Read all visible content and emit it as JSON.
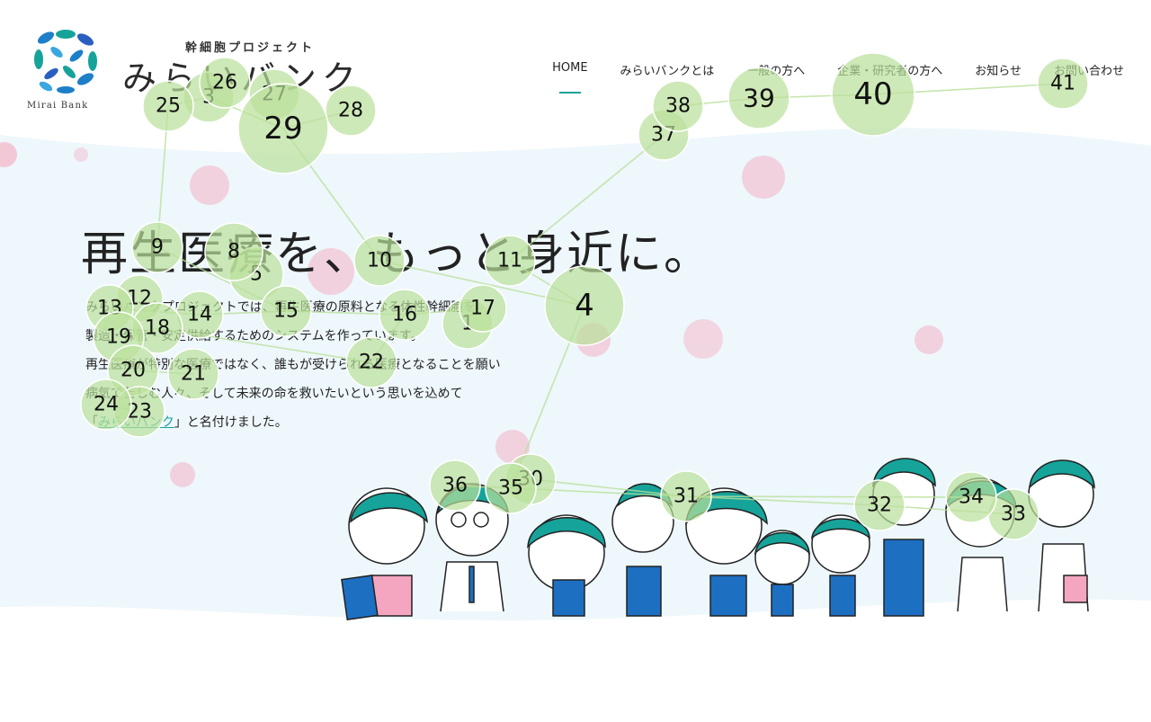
{
  "header": {
    "logo_caption": "Mirai Bank",
    "brand_sub": "幹細胞プロジェクト",
    "brand_main": "みらいバンク"
  },
  "nav": {
    "items": [
      {
        "label": "HOME",
        "active": true
      },
      {
        "label": "みらいバンクとは"
      },
      {
        "label": "一般の方へ"
      },
      {
        "label": "企業・研究者の方へ"
      },
      {
        "label": "お知らせ"
      },
      {
        "label": "お問い合わせ"
      }
    ]
  },
  "hero": {
    "headline": "再生医療を、もっと身近に。",
    "lead_line1": "みらいバンクプロジェクトでは、再生医療の原料となる体性幹細胞を",
    "lead_line2": "製造・保管・安定供給するためのシステムを作っています。",
    "lead_line3": "再生医療が特別な医療ではなく、誰もが受けられる医療となることを願い",
    "lead_line4": "病気で苦しむ人々、そして未来の命を救いたいという思いを込めて",
    "lead_line5_pre": "「",
    "lead_line5_link": "みらいバンク",
    "lead_line5_post": "」と名付けました。"
  },
  "colors": {
    "teal": "#16a39a",
    "hero_bg": "#eef7fc",
    "pink_dot": "#f2c2d3",
    "bubble_fill": "#b9e09a",
    "blue": "#1d6fc2"
  },
  "overlay_bubbles": [
    "1",
    "3",
    "4",
    "5",
    "8",
    "9",
    "10",
    "11",
    "12",
    "13",
    "14",
    "15",
    "16",
    "17",
    "18",
    "19",
    "20",
    "21",
    "22",
    "23",
    "24",
    "25",
    "26",
    "27",
    "28",
    "29",
    "30",
    "31",
    "32",
    "33",
    "34",
    "35",
    "36",
    "37",
    "38",
    "39",
    "40",
    "41"
  ]
}
